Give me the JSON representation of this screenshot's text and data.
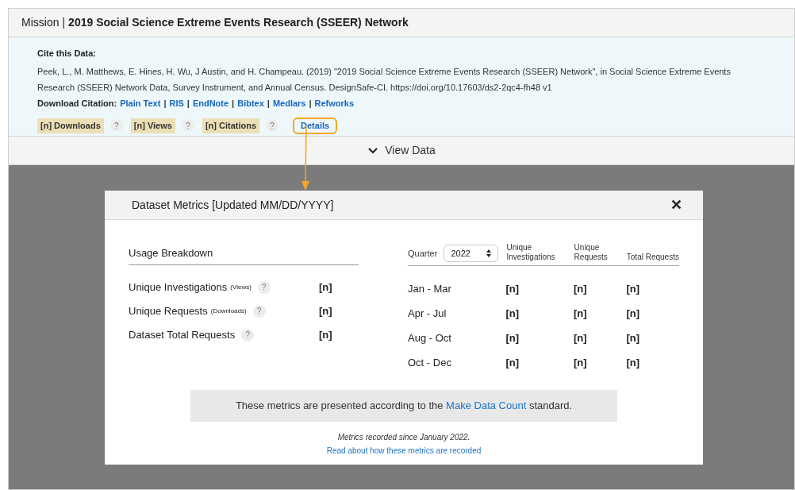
{
  "header": {
    "prefix": "Mission",
    "separator": "|",
    "title": "2019 Social Science Extreme Events Research (SSEER) Network"
  },
  "citation": {
    "heading": "Cite this Data:",
    "text": "Peek, L., M. Matthews, E. Hines, H. Wu, J Austin, and H. Champeau. (2019) \"2019 Social Science Extreme Events Research (SSEER) Network\", in Social Science Extreme Events Research (SSEER) Network Data, Survey Instrument, and Annual Census. DesignSafe-CI. https://doi.org/10.17603/ds2-2qc4-fh48 v1",
    "download_label": "Download Citation:",
    "separator": "|",
    "formats": [
      "Plain Text",
      "RIS",
      "EndNote",
      "Bibtex",
      "Medlars",
      "Refworks"
    ]
  },
  "metrics": [
    {
      "label": "[n] Downloads",
      "help": "?"
    },
    {
      "label": "[n] Views",
      "help": "?"
    },
    {
      "label": "[n] Citations",
      "help": "?"
    }
  ],
  "details": {
    "label": "Details",
    "highlighted": true
  },
  "view_data": {
    "label": "View Data",
    "expanded": false
  },
  "modal": {
    "title": "Dataset Metrics [Updated MM/DD/YYYY]",
    "close": "✕",
    "usage": {
      "heading": "Usage Breakdown",
      "rows": [
        {
          "label": "Unique Investigations",
          "note": "(Views)",
          "help": "?",
          "value": "[n]"
        },
        {
          "label": "Unique Requests",
          "note": "(Downloads)",
          "help": "?",
          "value": "[n]"
        },
        {
          "label": "Dataset Total Requests",
          "help": "?",
          "value": "[n]"
        }
      ]
    },
    "quarterly": {
      "label": "Quarter",
      "year": "2022",
      "columns": [
        "Unique Investigations",
        "Unique Requests",
        "Total Requests"
      ],
      "rows": [
        {
          "period": "Jan - Mar",
          "values": [
            "[n]",
            "[n]",
            "[n]"
          ]
        },
        {
          "period": "Apr - Jul",
          "values": [
            "[n]",
            "[n]",
            "[n]"
          ]
        },
        {
          "period": "Aug - Oct",
          "values": [
            "[n]",
            "[n]",
            "[n]"
          ]
        },
        {
          "period": "Oct - Dec",
          "values": [
            "[n]",
            "[n]",
            "[n]"
          ]
        }
      ]
    },
    "notice": {
      "before": "These metrics are presented according to the",
      "link": "Make Data Count",
      "after": "standard."
    },
    "since": "Metrics recorded since January 2022.",
    "read_more": "Read about how these metrics are recorded"
  }
}
